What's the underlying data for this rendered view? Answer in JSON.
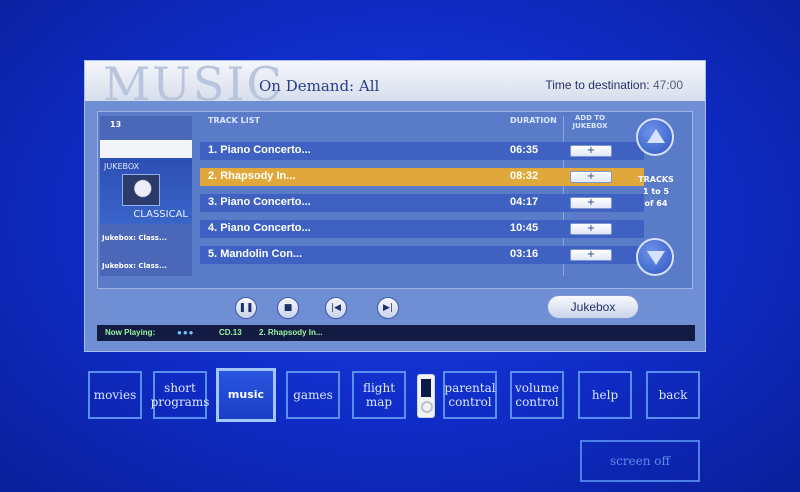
{
  "header": {
    "title_big": "MUSIC",
    "subtitle": "On Demand: All",
    "time_label": "Time to destination:",
    "time_value": "47:00"
  },
  "album": {
    "number": "13",
    "art_label_top": "JUKEBOX",
    "art_label_bottom": "CLASSICAL",
    "line1": "Jukebox: Class...",
    "line2": "Jukebox: Class..."
  },
  "track_list": {
    "header": "TRACK LIST",
    "duration_header": "DURATION",
    "add_header_line1": "ADD TO",
    "add_header_line2": "JUKEBOX",
    "add_label": "+",
    "tracks": [
      {
        "title": "1. Piano Concerto...",
        "duration": "06:35"
      },
      {
        "title": "2. Rhapsody In...",
        "duration": "08:32"
      },
      {
        "title": "3. Piano Concerto...",
        "duration": "04:17"
      },
      {
        "title": "4. Piano Concerto...",
        "duration": "10:45"
      },
      {
        "title": "5. Mandolin Con...",
        "duration": "03:16"
      }
    ]
  },
  "tracks_info": {
    "line1": "TRACKS",
    "line2": "1 to 5",
    "line3": "of 64"
  },
  "controls": {
    "pause": "❚❚",
    "stop": "■",
    "prev": "|◀",
    "next": "▶|",
    "jukebox_label": "Jukebox"
  },
  "now_playing": {
    "label": "Now Playing:",
    "dots": "●●●",
    "cd": "CD.13",
    "track": "2.   Rhapsody In..."
  },
  "nav": {
    "movies": "movies",
    "short_programs": "short programs",
    "music": "music",
    "games": "games",
    "flight_map": "flight map",
    "parental_control": "parental control",
    "volume_control": "volume control",
    "help": "help",
    "back": "back",
    "screen_off": "screen off"
  },
  "colors": {
    "background": "#1434d6",
    "selected_row": "#e0a83a",
    "row": "#3f62c2",
    "now_playing_text": "#9bf0a0"
  }
}
